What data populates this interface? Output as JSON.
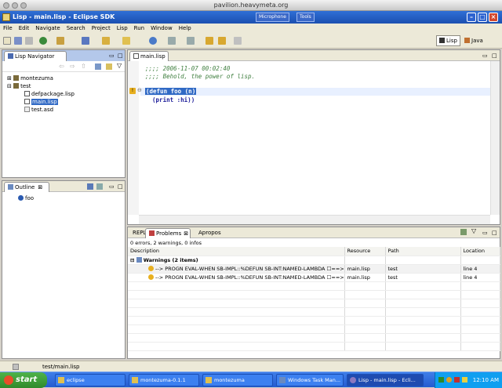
{
  "mac": {
    "host": "pavilion.heavymeta.org"
  },
  "window": {
    "title": "Lisp - main.lisp - Eclipse SDK",
    "mic_label": "Microphone",
    "tools_label": "Tools"
  },
  "menu": [
    "File",
    "Edit",
    "Navigate",
    "Search",
    "Project",
    "Lisp",
    "Run",
    "Window",
    "Help"
  ],
  "perspectives": {
    "lisp": "Lisp",
    "java": "Java"
  },
  "navigator": {
    "tab": "Lisp Navigator",
    "items": [
      "montezuma",
      "test",
      "defpackage.lisp",
      "main.lisp",
      "test.asd"
    ]
  },
  "outline": {
    "tab": "Outline",
    "items": [
      "foo"
    ]
  },
  "editor": {
    "tab": "main.lisp",
    "lines": [
      ";;;; 2006-11-07 00:02:40",
      ";;;; Behold, the power of lisp.",
      "(defun foo (n)",
      "  (print :hi))"
    ]
  },
  "bottom": {
    "tabs": [
      "REPL",
      "Problems",
      "Apropos"
    ],
    "summary": "0 errors, 2 warnings, 0 infos",
    "columns": [
      "Description",
      "Resource",
      "Path",
      "Location"
    ],
    "group": "Warnings (2 items)",
    "rows": [
      {
        "desc": "--> PROGN EVAL-WHEN SB-IMPL::%DEFUN SB-INT:NAMED-LAMBDA ☐==>☐",
        "resource": "main.lisp",
        "path": "test",
        "location": "line 4"
      },
      {
        "desc": "--> PROGN EVAL-WHEN SB-IMPL::%DEFUN SB-INT:NAMED-LAMBDA ☐==>☐",
        "resource": "main.lisp",
        "path": "test",
        "location": "line 4"
      }
    ]
  },
  "status": {
    "path": "test/main.lisp"
  },
  "taskbar": {
    "start": "start",
    "items": [
      "eclipse",
      "montezuma-0.1.1",
      "montezuma",
      "Windows Task Man...",
      "Lisp - main.lisp - Ecli..."
    ],
    "clock": "12:10 AM"
  }
}
